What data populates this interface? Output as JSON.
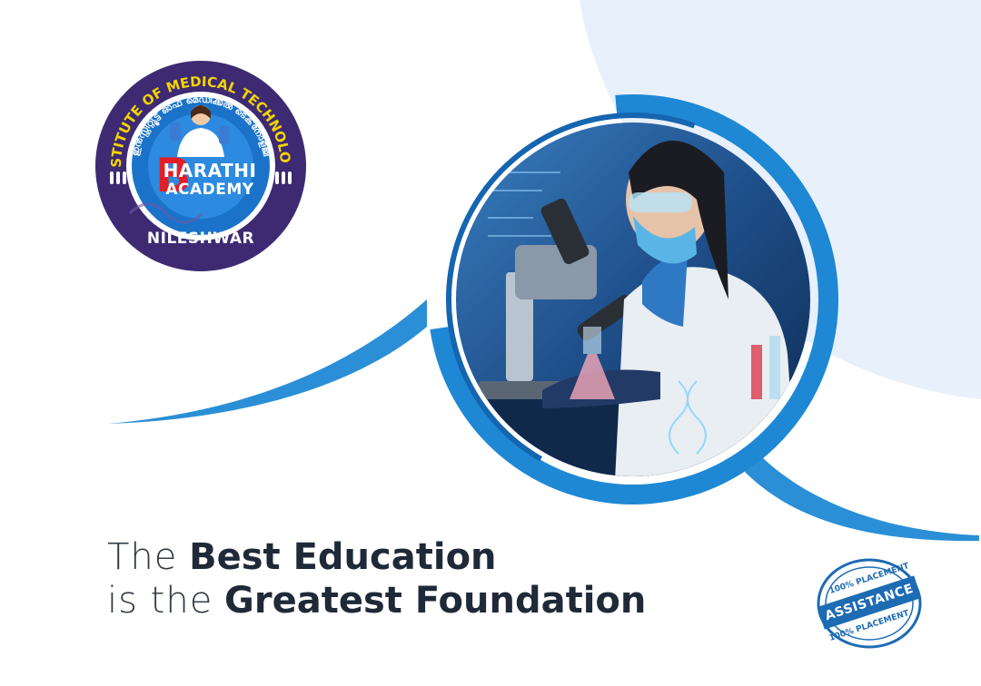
{
  "logo": {
    "arc_top": "INSTITUTE OF MEDICAL TECHNOLOGY",
    "arc_malayalam": "ഇൻസ്റ്റിറ്റ്യൂട്ട് ഓഫ് മെഡിക്കൽ ടെക്‌നോളജി",
    "big_letter": "B",
    "name_line1": "HARATHI",
    "name_line2": "ACADEMY",
    "place": "NILESHWAR"
  },
  "headline": {
    "line1_light": "The",
    "line1_bold": "Best Education",
    "line2_light": "is the",
    "line2_bold": "Greatest Foundation"
  },
  "stamp": {
    "top_text": "100% PLACEMENT",
    "main_text": "ASSISTANCE",
    "bottom_text": "100% PLACEMENT"
  },
  "colors": {
    "brand_blue": "#1d6bb3",
    "light_bg": "#e8f0fb",
    "logo_purple": "#3d2a73",
    "logo_yellow": "#f4d400",
    "text_dark": "#1f2937"
  },
  "icons": {
    "photo": "lab-scientist-microscope-photo",
    "stamp": "placement-assistance-stamp"
  }
}
